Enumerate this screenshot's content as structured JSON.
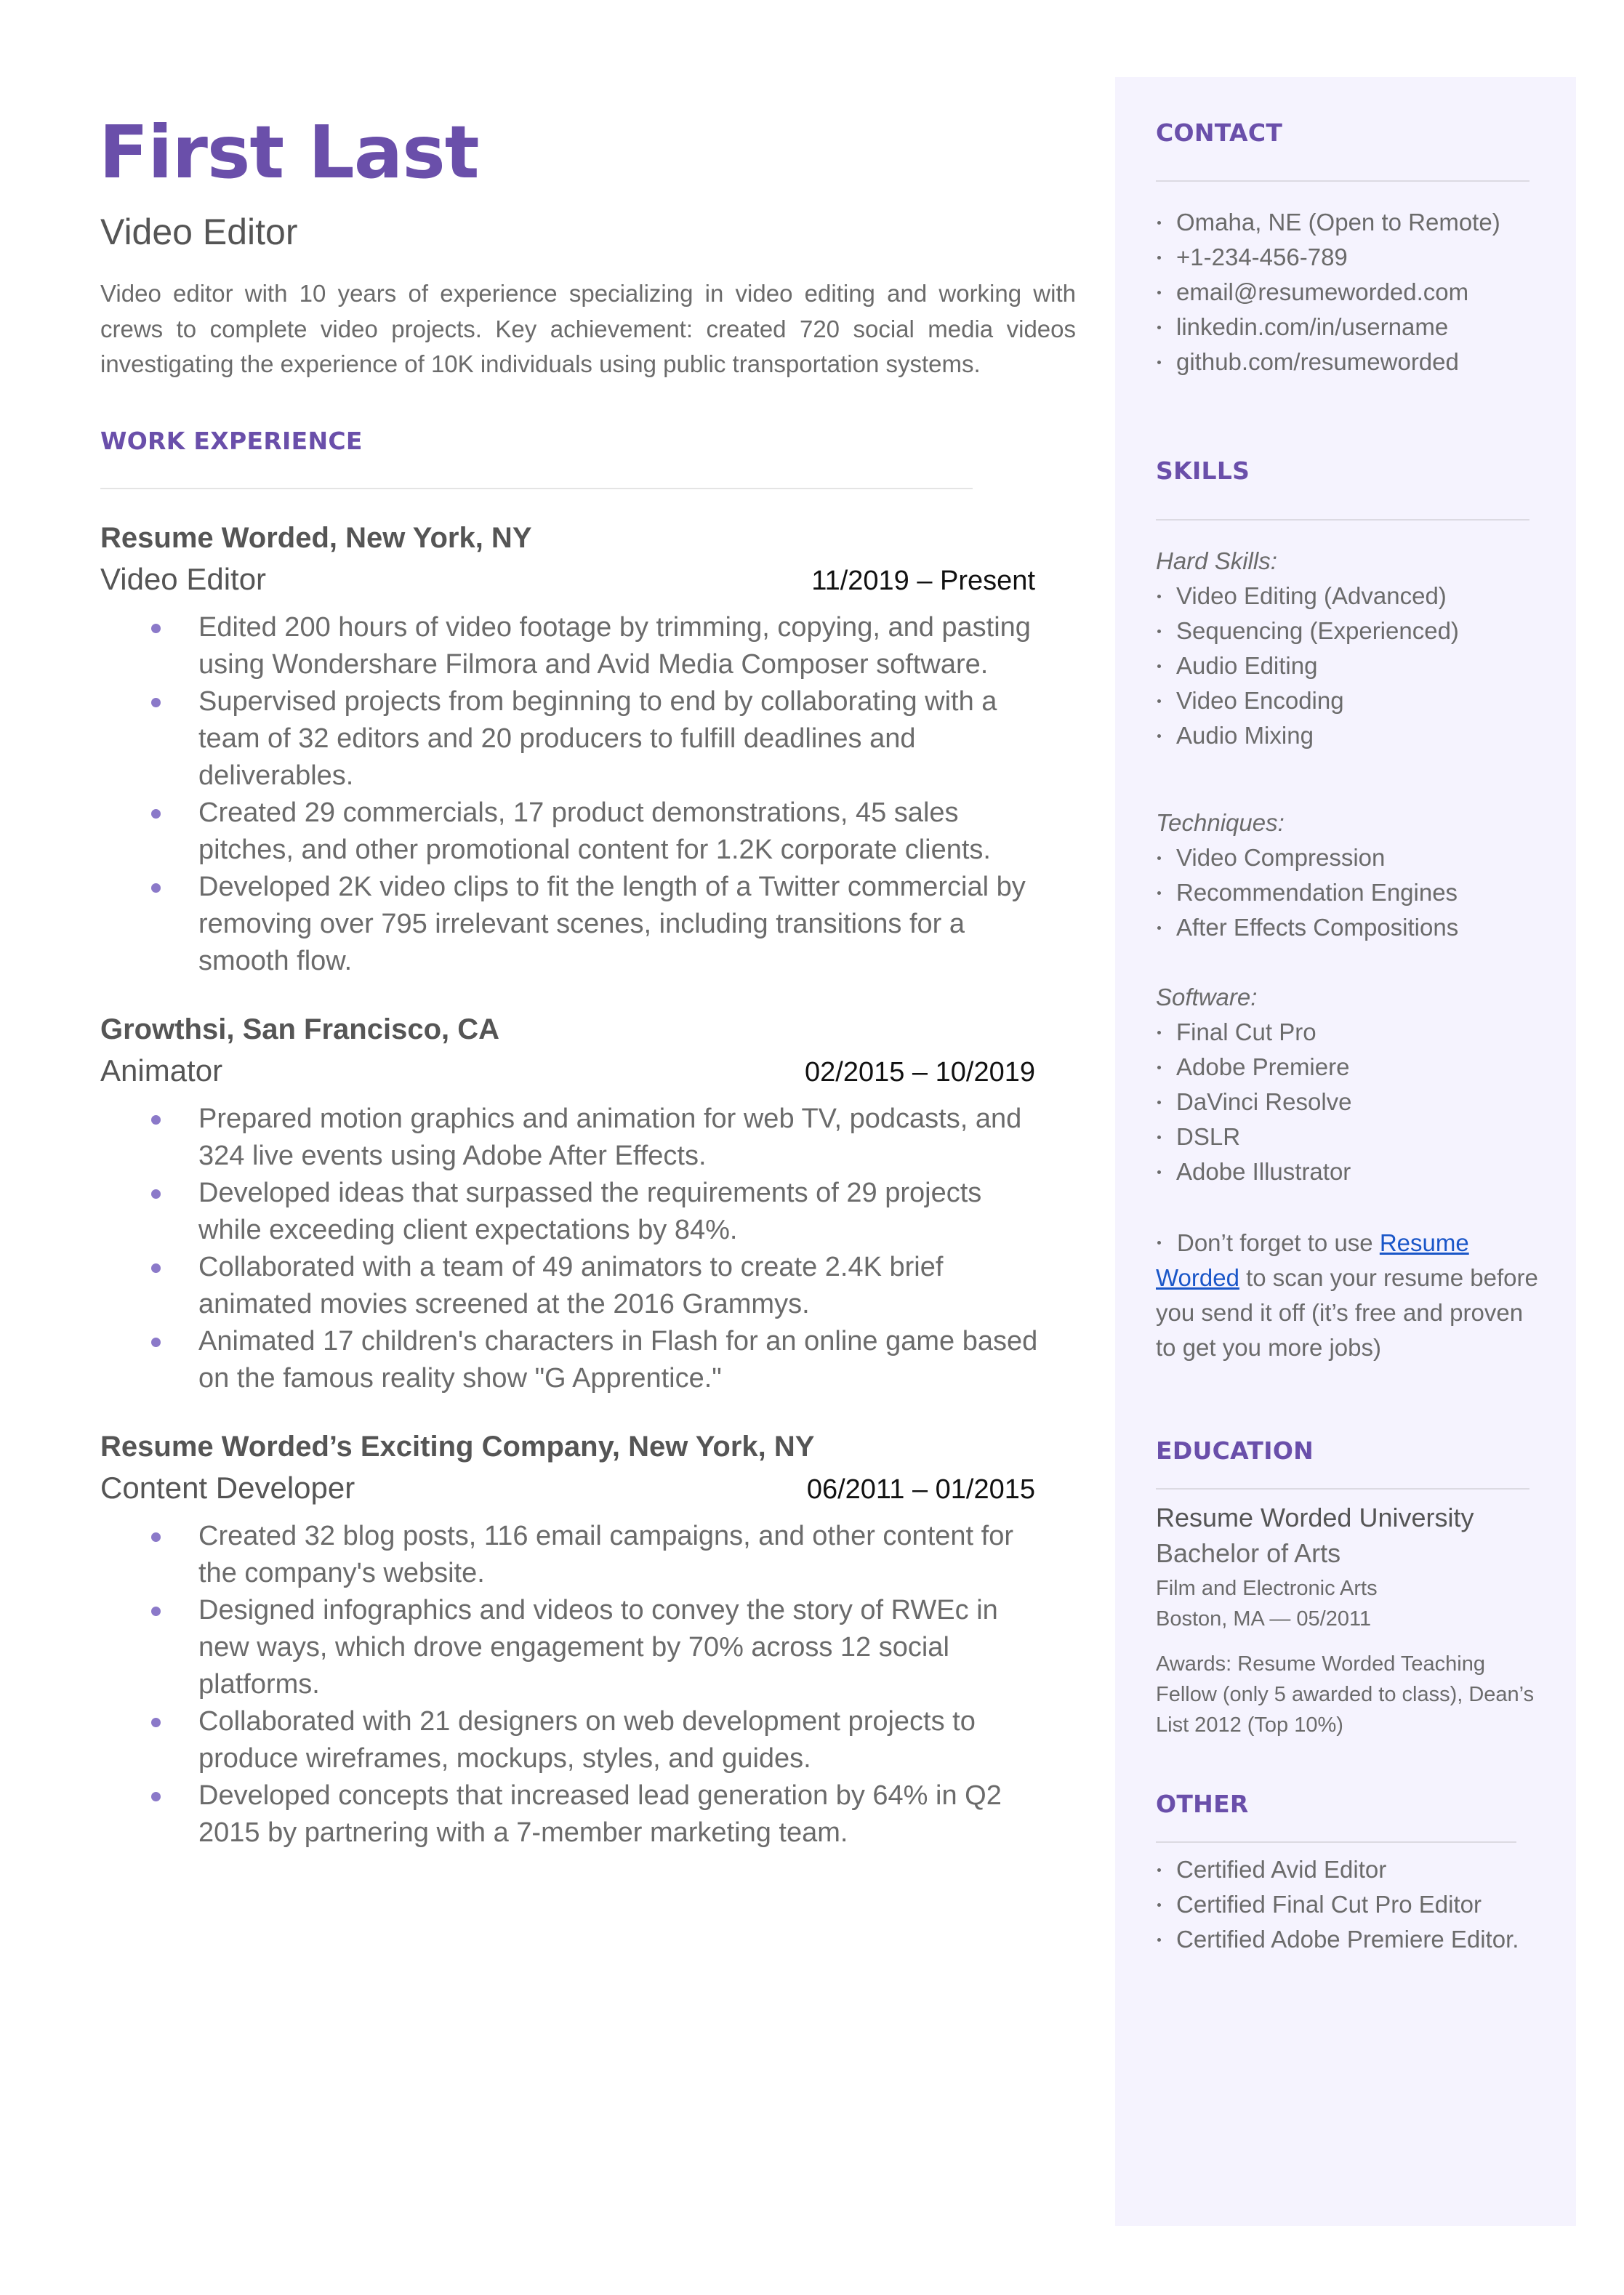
{
  "header": {
    "name": "First Last",
    "title": "Video Editor",
    "summary": "Video editor with 10 years of experience specializing in video editing and working with crews to complete video projects. Key achievement: created 720 social media videos investigating the experience of 10K individuals using public transportation systems."
  },
  "work": {
    "heading": "WORK EXPERIENCE",
    "jobs": [
      {
        "company": "Resume Worded, New York, NY",
        "title": "Video Editor",
        "dates": "11/2019 – Present",
        "bullets": [
          "Edited 200 hours of video footage by trimming, copying, and pasting using Wondershare Filmora and Avid Media Composer software.",
          "Supervised projects from beginning to end by collaborating with a team of 32 editors and 20 producers to fulfill deadlines and deliverables.",
          "Created 29 commercials, 17 product demonstrations, 45 sales pitches, and other promotional content for 1.2K corporate clients.",
          "Developed 2K video clips to fit the length of a Twitter commercial by removing over 795 irrelevant scenes, including transitions for a smooth flow."
        ]
      },
      {
        "company": "Growthsi, San Francisco, CA",
        "title": "Animator",
        "dates": "02/2015 – 10/2019",
        "bullets": [
          "Prepared motion graphics and animation for web TV, podcasts, and 324 live events using Adobe After Effects.",
          "Developed ideas that surpassed the requirements of 29 projects while exceeding client expectations by 84%.",
          "Collaborated with a team of 49 animators to create 2.4K brief animated movies screened at the 2016 Grammys.",
          "Animated 17 children's characters in Flash for an online game based on the famous reality show \"G Apprentice.\""
        ]
      },
      {
        "company": "Resume Worded’s Exciting Company, New York, NY",
        "title": "Content Developer",
        "dates": "06/2011 – 01/2015",
        "bullets": [
          "Created 32 blog posts, 116 email campaigns, and other content for the company's website.",
          "Designed infographics and videos to convey the story of RWEc in new ways, which drove engagement by 70% across 12 social platforms.",
          "Collaborated with 21 designers on web development projects to produce wireframes, mockups, styles, and guides.",
          "Developed concepts that increased lead generation by 64% in Q2 2015 by partnering with a 7-member marketing team."
        ]
      }
    ]
  },
  "sidebar": {
    "contact": {
      "heading": "CONTACT",
      "items": [
        "Omaha, NE (Open to Remote)",
        "+1-234-456-789",
        "email@resumeworded.com",
        "linkedin.com/in/username",
        "github.com/resumeworded"
      ]
    },
    "skills": {
      "heading": "SKILLS",
      "groups": [
        {
          "label": "Hard Skills:",
          "items": [
            "Video Editing (Advanced)",
            "Sequencing (Experienced)",
            "Audio Editing",
            "Video Encoding",
            "Audio Mixing"
          ]
        },
        {
          "label": "Techniques:",
          "items": [
            "Video Compression",
            "Recommendation Engines",
            "After Effects Compositions"
          ]
        },
        {
          "label": "Software:",
          "items": [
            "Final Cut Pro",
            "Adobe Premiere",
            "DaVinci Resolve",
            "DSLR",
            "Adobe Illustrator"
          ]
        }
      ],
      "note": {
        "before": "Don’t forget to use ",
        "link": "Resume Worded",
        "after": " to scan your resume before you send it off (it’s free and proven to get you more jobs)"
      }
    },
    "education": {
      "heading": "EDUCATION",
      "school": "Resume Worded University",
      "degree": "Bachelor of Arts",
      "field": "Film and Electronic Arts",
      "location_date": "Boston, MA — 05/2011",
      "awards": "Awards: Resume Worded Teaching Fellow (only 5 awarded to class), Dean’s List 2012 (Top 10%)"
    },
    "other": {
      "heading": "OTHER",
      "items": [
        "Certified Avid Editor",
        "Certified Final Cut Pro Editor",
        "Certified Adobe Premiere Editor."
      ]
    }
  },
  "colors": {
    "accent": "#6A4FAA",
    "bullet": "#8B79C9",
    "sidebar_bg": "#F5F3FE",
    "link": "#1A56C8"
  }
}
